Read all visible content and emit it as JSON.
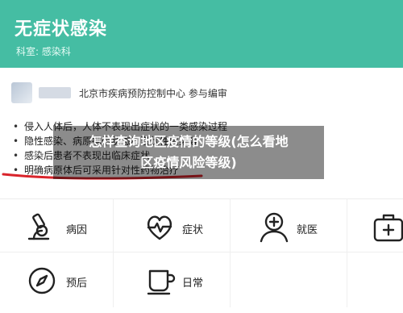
{
  "header": {
    "title": "无症状感染",
    "subtitle": "科室: 感染科"
  },
  "meta": {
    "source_text": "北京市疾病预防控制中心 参与编审"
  },
  "bullets": [
    "侵入人体后，人体不表现出症状的一类感染过程",
    "隐性感染、病原携带状态和潜伏性感染等",
    "感染后患者不表现出临床症状",
    "明确病原体后可采用针对性药物治疗"
  ],
  "overlay": {
    "line1": "怎样查询地区疫情的等级(怎么看地",
    "line2": "区疫情风险等级)"
  },
  "grid": [
    {
      "label": "病因",
      "icon": "microscope-icon"
    },
    {
      "label": "症状",
      "icon": "heart-pulse-icon"
    },
    {
      "label": "就医",
      "icon": "doctor-icon"
    },
    {
      "label": "",
      "icon": "first-aid-kit-icon"
    },
    {
      "label": "预后",
      "icon": "compass-icon"
    },
    {
      "label": "日常",
      "icon": "cup-icon"
    }
  ],
  "colors": {
    "header_bg": "#45bda3",
    "icon_stroke": "#222222",
    "annotation_red": "#d9242b"
  }
}
